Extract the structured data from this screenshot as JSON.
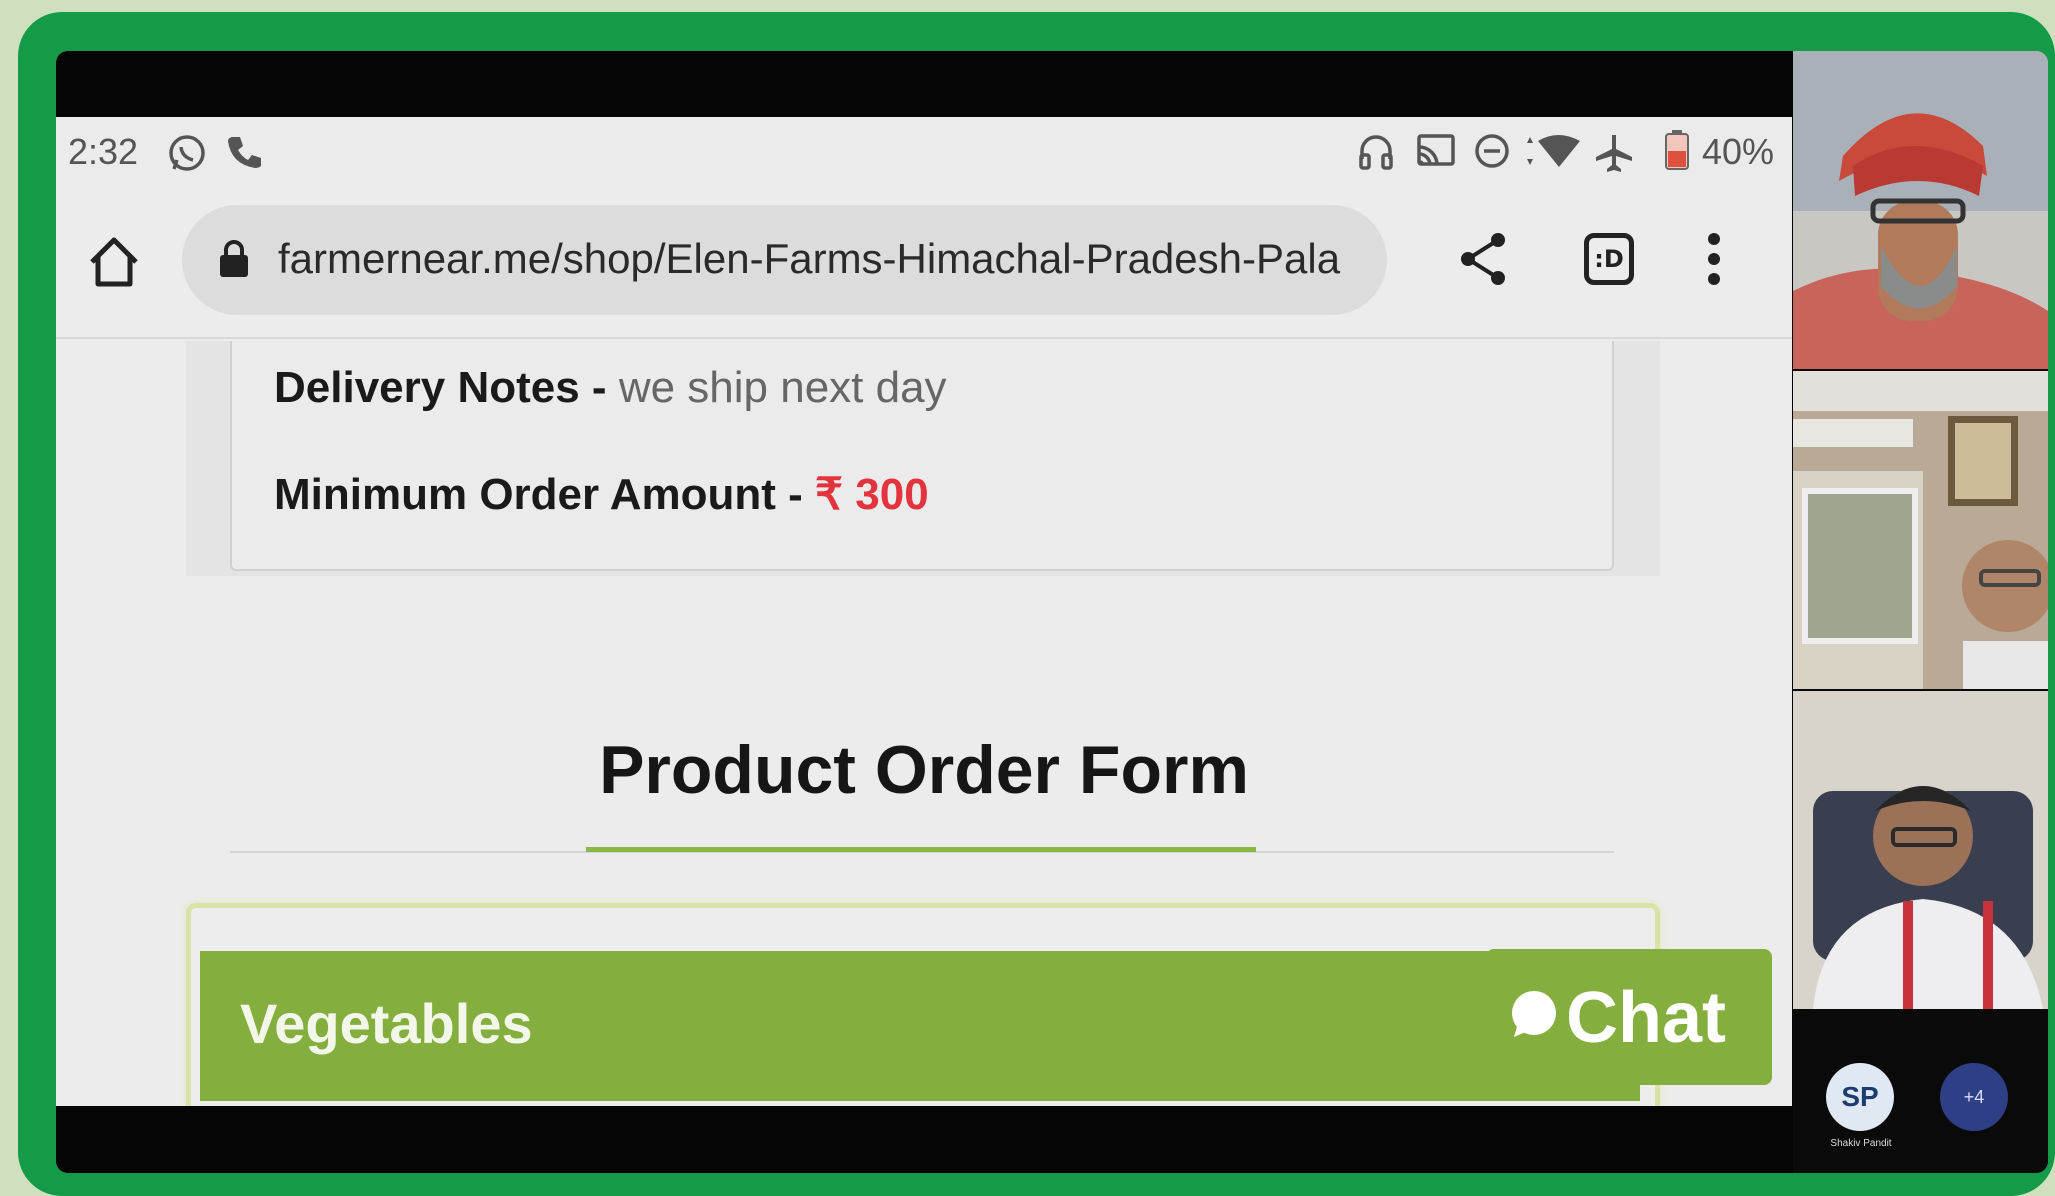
{
  "status_bar": {
    "time": "2:32",
    "battery_text": "40%",
    "icons": [
      "whatsapp-icon",
      "phone-call-icon",
      "headphones-icon",
      "cast-icon",
      "do-not-disturb-icon",
      "wifi-icon",
      "airplane-mode-icon",
      "battery-icon"
    ]
  },
  "browser": {
    "url": "farmernear.me/shop/Elen-Farms-Himachal-Pradesh-Pala",
    "tabs_label": ":D",
    "icons": [
      "home-icon",
      "lock-icon",
      "share-icon",
      "tabs-icon",
      "more-vert-icon"
    ]
  },
  "store_info": {
    "delivery_label": "Delivery Notes -",
    "delivery_value": "we ship next day",
    "min_order_label": "Minimum Order Amount -",
    "min_order_value": "₹ 300"
  },
  "form": {
    "title": "Product Order Form",
    "category": "Vegetables"
  },
  "chat": {
    "label": "Chat"
  },
  "participants": {
    "avatar_initials": "SP",
    "avatar_name": "Shakiv Pandit",
    "more_count": "+4"
  },
  "colors": {
    "frame_green": "#159a48",
    "accent_green": "#84ae3e",
    "price_red": "#e3333d"
  }
}
